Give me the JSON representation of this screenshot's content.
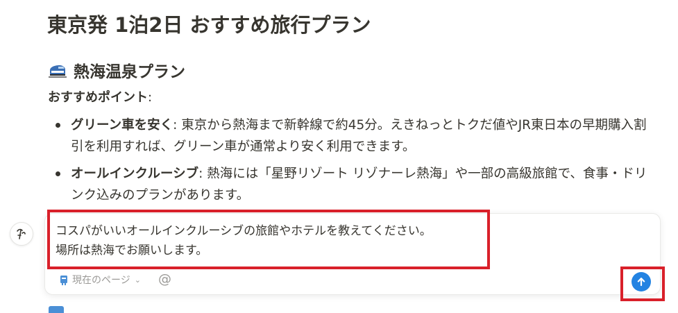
{
  "doc": {
    "title": "東京発 1泊2日 おすすめ旅行プラン",
    "section": {
      "icon": "bullet-train-icon",
      "heading": "熱海温泉プラン",
      "points_label": "おすすめポイント",
      "points_colon": ":",
      "bullets": [
        {
          "title": "グリーン車を安く",
          "colon": ":",
          "text": "東京から熱海まで新幹線で約45分。えきねっとトクだ値やJR東日本の早期購入割引を利用すれば、グリーン車が通常より安く利用できます。"
        },
        {
          "title": "オールインクルーシブ",
          "colon": ":",
          "text": "熱海には「星野リゾート リゾナーレ熱海」や一部の高級旅館で、食事・ドリンク込みのプランがあります。"
        }
      ]
    }
  },
  "ai_chat": {
    "avatar_icon": "notion-ai-face-icon",
    "prompt_line1": "コスパがいいオールインクルーシブの旅館やホテルを教えてください。",
    "prompt_line2": "場所は熱海でお願いします。",
    "context_label": "現在のページ",
    "context_icon": "page-icon",
    "mention_symbol": "@",
    "send_icon": "arrow-up-icon"
  },
  "colors": {
    "accent_blue": "#2383e2",
    "highlight_red": "#d9202a",
    "text": "#37352f",
    "muted": "#9b9a97"
  }
}
